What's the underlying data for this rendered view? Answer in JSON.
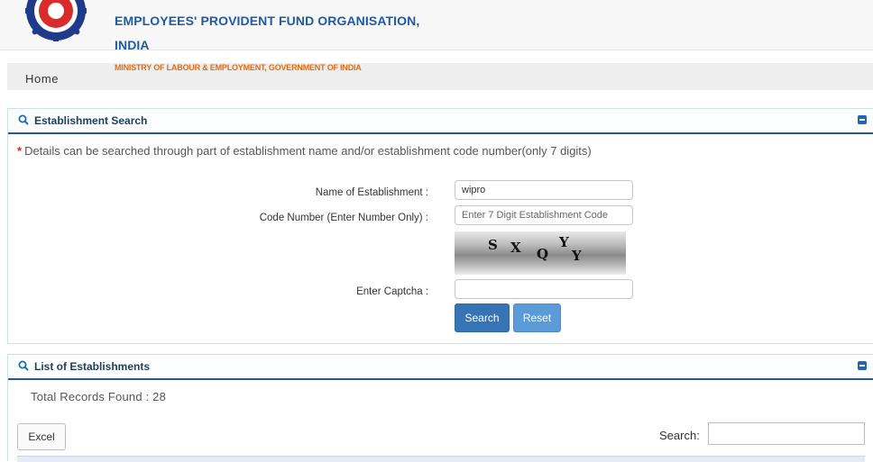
{
  "header": {
    "org_line1": "EMPLOYEES' PROVIDENT FUND ORGANISATION,",
    "org_line2": "INDIA",
    "ministry": "MINISTRY OF LABOUR & EMPLOYMENT, GOVERNMENT OF INDIA",
    "logo_icon": "epfo-logo-icon"
  },
  "nav": {
    "home": "Home"
  },
  "search_panel": {
    "title": "Establishment Search",
    "note_star": "*",
    "note": "Details can be searched through part of establishment name and/or establishment code number(only 7 digits)",
    "name_label": "Name of Establishment :",
    "name_value": "wipro",
    "code_label": "Code Number (Enter Number Only) :",
    "code_placeholder": "Enter 7 Digit Establishment Code",
    "captcha_chars": [
      "S",
      "X",
      "Q",
      "Y",
      "Y"
    ],
    "captcha_label": "Enter Captcha :",
    "captcha_value": "",
    "search_button": "Search",
    "reset_button": "Reset"
  },
  "list_panel": {
    "title": "List of Establishments",
    "records": "Total Records Found : 28",
    "excel_button": "Excel",
    "search_label": "Search:",
    "search_value": ""
  },
  "colors": {
    "accent": "#1f5aa6",
    "ministry": "#e46b12",
    "button": "#3774b5"
  }
}
